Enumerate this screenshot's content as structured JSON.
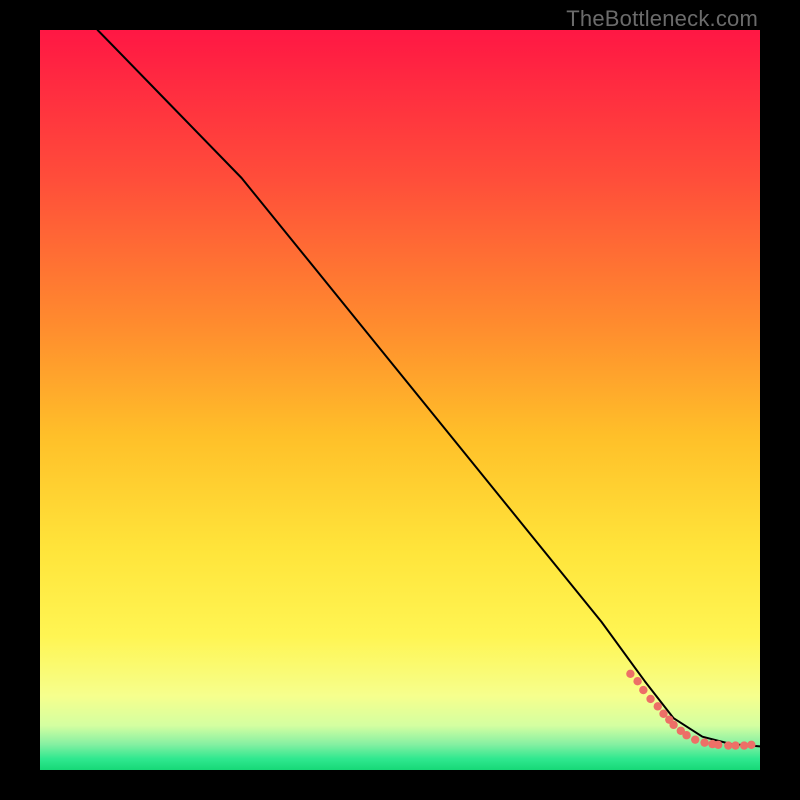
{
  "attribution": "TheBottleneck.com",
  "chart_data": {
    "type": "line",
    "title": "",
    "xlabel": "",
    "ylabel": "",
    "xlim": [
      0,
      100
    ],
    "ylim": [
      0,
      100
    ],
    "grid": false,
    "legend": false,
    "background_gradient": {
      "stops": [
        {
          "offset": 0.0,
          "color": "#ff1744"
        },
        {
          "offset": 0.2,
          "color": "#ff4d3a"
        },
        {
          "offset": 0.4,
          "color": "#ff8c2e"
        },
        {
          "offset": 0.55,
          "color": "#ffc029"
        },
        {
          "offset": 0.7,
          "color": "#ffe43a"
        },
        {
          "offset": 0.82,
          "color": "#fff553"
        },
        {
          "offset": 0.9,
          "color": "#f6ff8d"
        },
        {
          "offset": 0.94,
          "color": "#d4ffa1"
        },
        {
          "offset": 0.965,
          "color": "#86f0a2"
        },
        {
          "offset": 0.985,
          "color": "#2fe88f"
        },
        {
          "offset": 1.0,
          "color": "#17d877"
        }
      ]
    },
    "series": [
      {
        "name": "curve",
        "stroke": "#000000",
        "stroke_width": 2,
        "x": [
          8,
          18,
          28,
          38,
          48,
          58,
          68,
          78,
          84,
          88,
          92,
          96,
          100
        ],
        "y": [
          100,
          90,
          80,
          68,
          56,
          44,
          32,
          20,
          12,
          7,
          4.5,
          3.5,
          3.2
        ]
      }
    ],
    "scatter": {
      "name": "points",
      "color": "#ed6f67",
      "radius": 4.2,
      "x": [
        82,
        83,
        83.8,
        84.8,
        85.8,
        86.6,
        87.4,
        88,
        89,
        89.8,
        91,
        92.3,
        93.4,
        94.2,
        95.6,
        96.6,
        97.8,
        98.8
      ],
      "y": [
        13.0,
        12.0,
        10.8,
        9.6,
        8.6,
        7.6,
        6.8,
        6.1,
        5.3,
        4.7,
        4.1,
        3.7,
        3.5,
        3.4,
        3.3,
        3.3,
        3.3,
        3.4
      ]
    }
  }
}
